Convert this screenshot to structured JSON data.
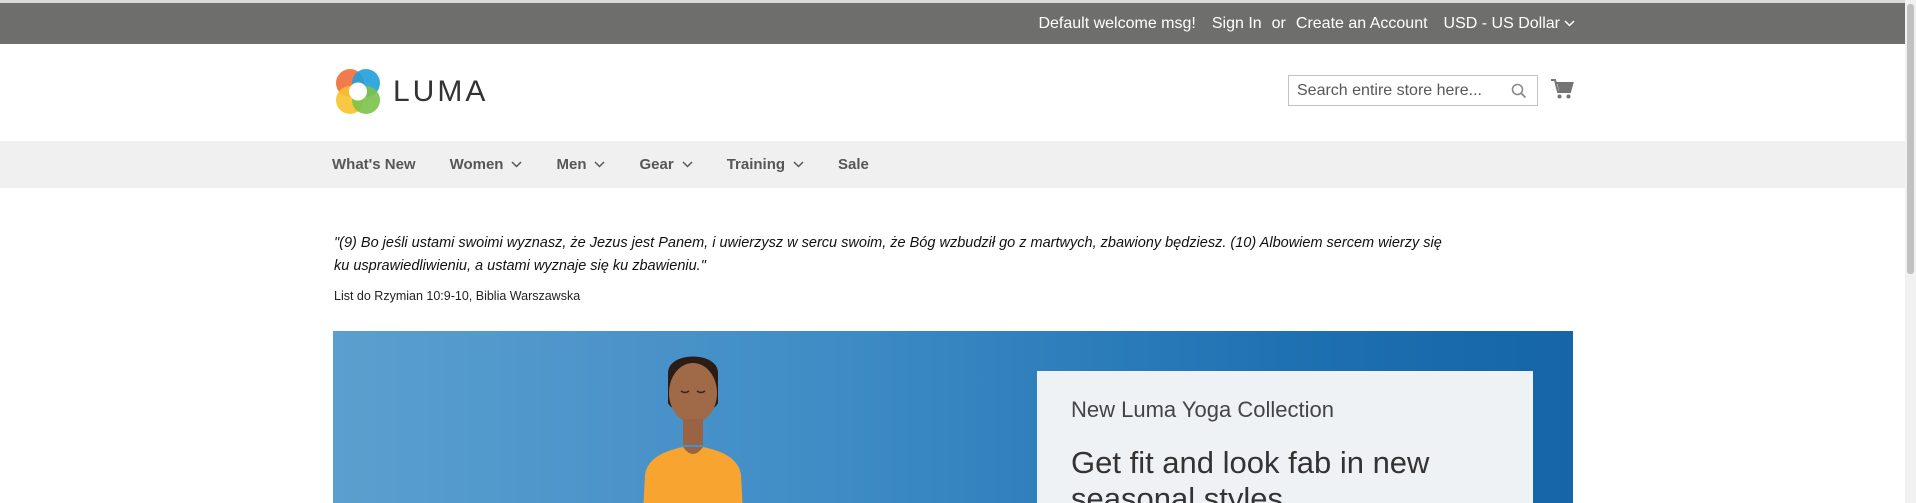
{
  "panel": {
    "welcome": "Default welcome msg!",
    "sign_in": "Sign In",
    "or": "or",
    "create_account": "Create an Account",
    "currency": "USD - US Dollar"
  },
  "header": {
    "logo_text": "LUMA",
    "search_placeholder": "Search entire store here...",
    "icons": {
      "search": "search-icon",
      "cart": "cart-icon"
    }
  },
  "nav": {
    "items": [
      {
        "label": "What's New",
        "has_children": false
      },
      {
        "label": "Women",
        "has_children": true
      },
      {
        "label": "Men",
        "has_children": true
      },
      {
        "label": "Gear",
        "has_children": true
      },
      {
        "label": "Training",
        "has_children": true
      },
      {
        "label": "Sale",
        "has_children": false
      }
    ]
  },
  "content": {
    "quote": "\"(9) Bo jeśli ustami swoimi wyznasz, że Jezus jest Panem, i uwierzysz w sercu swoim, że Bóg wzbudził go z martwych, zbawiony będziesz. (10) Albowiem sercem wierzy się ku usprawiedliwieniu, a ustami wyznaje się ku zbawieniu.\"",
    "source": "List do Rzymian 10:9-10, Biblia Warszawska"
  },
  "hero": {
    "kicker": "New Luma Yoga Collection",
    "headline": "Get fit and look fab in new seasonal styles"
  },
  "colors": {
    "panel_bg": "#6e6e6c",
    "nav_bg": "#f0f0f0",
    "hero_blue": "#1c6fb0",
    "hero_orange": "#f7a530"
  }
}
